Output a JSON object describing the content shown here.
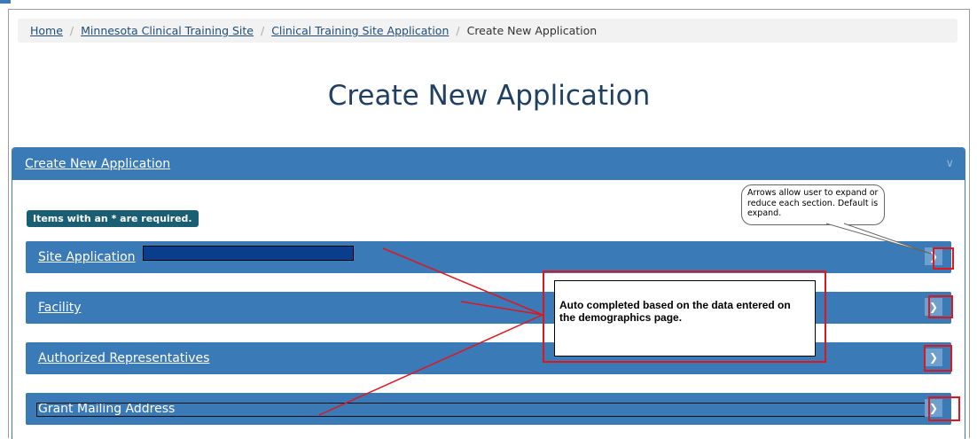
{
  "breadcrumb": {
    "home": "Home",
    "site": "Minnesota Clinical Training Site",
    "application": "Clinical Training Site Application",
    "current": "Create New Application",
    "separator": "/"
  },
  "page_title": "Create New Application",
  "panel": {
    "header": "Create New Application",
    "required_note": "Items with an * are required."
  },
  "sections": [
    {
      "label": "Site Application "
    },
    {
      "label": "Facility"
    },
    {
      "label": "Authorized Representatives"
    },
    {
      "label": "Grant Mailing Address"
    }
  ],
  "annotations": {
    "callout": "Auto completed based on the data entered on the demographics page.",
    "bubble": "Arrows allow user to expand or reduce each section. Default is expand."
  },
  "icons": {
    "panel_toggle": "chevron-down-icon",
    "section_toggle": "chevron-right-icon"
  },
  "colors": {
    "primary": "#3a7ab7",
    "title": "#1f3f63",
    "badge": "#1a5e73",
    "annotation_red": "#e0161e"
  }
}
